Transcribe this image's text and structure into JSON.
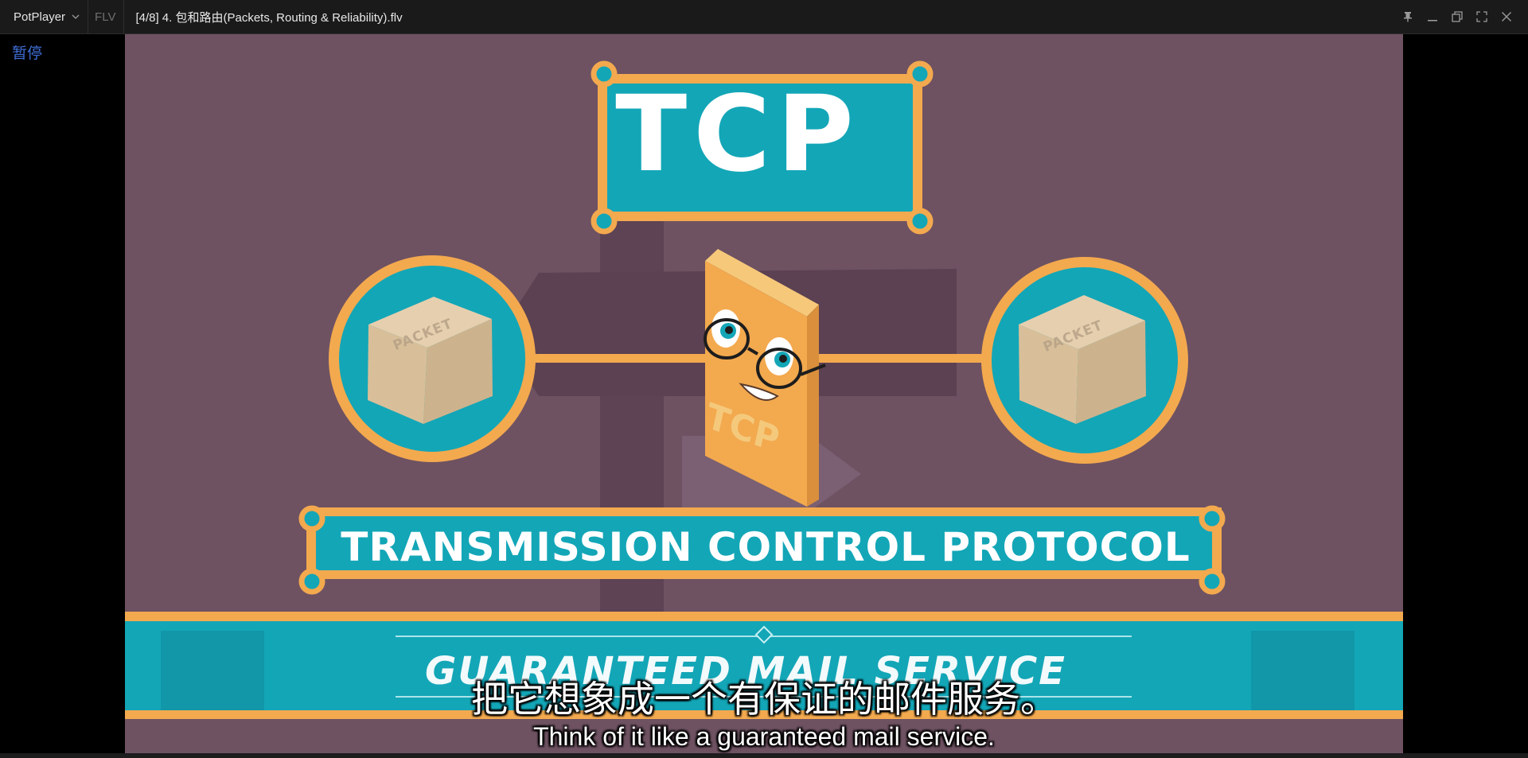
{
  "titlebar": {
    "app_name": "PotPlayer",
    "format": "FLV",
    "file_title": "[4/8] 4. 包和路由(Packets, Routing & Reliability).flv"
  },
  "window_buttons": [
    "pin-icon",
    "minimize-icon",
    "restore-icon",
    "fullscreen-icon",
    "close-icon"
  ],
  "osd": {
    "status": "暂停"
  },
  "video": {
    "sign_title": "TCP",
    "banner": "TRANSMISSION CONTROL PROTOCOL",
    "strip_text": "GUARANTEED MAIL SERVICE",
    "packet_label": "PACKET",
    "character_label": "TCP",
    "colors": {
      "background": "#6e5262",
      "teal": "#13a6b7",
      "orange": "#f3a94e"
    }
  },
  "subtitles": {
    "zh": "把它想象成一个有保证的邮件服务。",
    "en": "Think of it like a guaranteed mail service."
  }
}
